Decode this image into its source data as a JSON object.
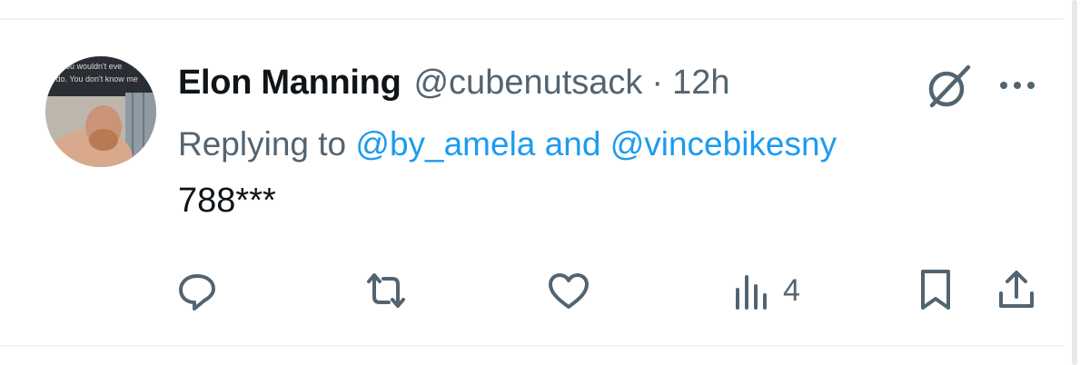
{
  "tweet": {
    "display_name": "Elon Manning",
    "handle": "@cubenutsack",
    "separator": "·",
    "time": "12h",
    "replying_prefix": "Replying to",
    "replying_mention_1": "@by_amela",
    "replying_joiner": "and",
    "replying_mention_2": "@vincebikesny",
    "text": "788***",
    "views_count": "4"
  },
  "avatar": {
    "overlay_line_1": "st you wouldn't eve",
    "overlay_line_2": "o do. You don't know me"
  },
  "icons": {
    "grok": "grok-icon",
    "more": "more-icon",
    "reply": "reply-icon",
    "retweet": "retweet-icon",
    "like": "like-icon",
    "views": "views-icon",
    "bookmark": "bookmark-icon",
    "share": "share-icon"
  },
  "colors": {
    "text_primary": "#0f1419",
    "text_secondary": "#536471",
    "accent": "#1d9bf0",
    "divider": "#eff3f4"
  }
}
